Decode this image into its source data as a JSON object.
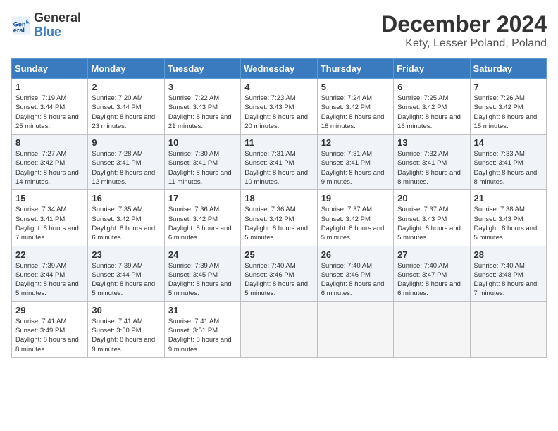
{
  "logo": {
    "line1": "General",
    "line2": "Blue"
  },
  "title": "December 2024",
  "subtitle": "Kety, Lesser Poland, Poland",
  "weekdays": [
    "Sunday",
    "Monday",
    "Tuesday",
    "Wednesday",
    "Thursday",
    "Friday",
    "Saturday"
  ],
  "weeks": [
    [
      {
        "day": "1",
        "sunrise": "7:19 AM",
        "sunset": "3:44 PM",
        "daylight": "8 hours and 25 minutes."
      },
      {
        "day": "2",
        "sunrise": "7:20 AM",
        "sunset": "3:44 PM",
        "daylight": "8 hours and 23 minutes."
      },
      {
        "day": "3",
        "sunrise": "7:22 AM",
        "sunset": "3:43 PM",
        "daylight": "8 hours and 21 minutes."
      },
      {
        "day": "4",
        "sunrise": "7:23 AM",
        "sunset": "3:43 PM",
        "daylight": "8 hours and 20 minutes."
      },
      {
        "day": "5",
        "sunrise": "7:24 AM",
        "sunset": "3:42 PM",
        "daylight": "8 hours and 18 minutes."
      },
      {
        "day": "6",
        "sunrise": "7:25 AM",
        "sunset": "3:42 PM",
        "daylight": "8 hours and 16 minutes."
      },
      {
        "day": "7",
        "sunrise": "7:26 AM",
        "sunset": "3:42 PM",
        "daylight": "8 hours and 15 minutes."
      }
    ],
    [
      {
        "day": "8",
        "sunrise": "7:27 AM",
        "sunset": "3:42 PM",
        "daylight": "8 hours and 14 minutes."
      },
      {
        "day": "9",
        "sunrise": "7:28 AM",
        "sunset": "3:41 PM",
        "daylight": "8 hours and 12 minutes."
      },
      {
        "day": "10",
        "sunrise": "7:30 AM",
        "sunset": "3:41 PM",
        "daylight": "8 hours and 11 minutes."
      },
      {
        "day": "11",
        "sunrise": "7:31 AM",
        "sunset": "3:41 PM",
        "daylight": "8 hours and 10 minutes."
      },
      {
        "day": "12",
        "sunrise": "7:31 AM",
        "sunset": "3:41 PM",
        "daylight": "8 hours and 9 minutes."
      },
      {
        "day": "13",
        "sunrise": "7:32 AM",
        "sunset": "3:41 PM",
        "daylight": "8 hours and 8 minutes."
      },
      {
        "day": "14",
        "sunrise": "7:33 AM",
        "sunset": "3:41 PM",
        "daylight": "8 hours and 8 minutes."
      }
    ],
    [
      {
        "day": "15",
        "sunrise": "7:34 AM",
        "sunset": "3:41 PM",
        "daylight": "8 hours and 7 minutes."
      },
      {
        "day": "16",
        "sunrise": "7:35 AM",
        "sunset": "3:42 PM",
        "daylight": "8 hours and 6 minutes."
      },
      {
        "day": "17",
        "sunrise": "7:36 AM",
        "sunset": "3:42 PM",
        "daylight": "8 hours and 6 minutes."
      },
      {
        "day": "18",
        "sunrise": "7:36 AM",
        "sunset": "3:42 PM",
        "daylight": "8 hours and 5 minutes."
      },
      {
        "day": "19",
        "sunrise": "7:37 AM",
        "sunset": "3:42 PM",
        "daylight": "8 hours and 5 minutes."
      },
      {
        "day": "20",
        "sunrise": "7:37 AM",
        "sunset": "3:43 PM",
        "daylight": "8 hours and 5 minutes."
      },
      {
        "day": "21",
        "sunrise": "7:38 AM",
        "sunset": "3:43 PM",
        "daylight": "8 hours and 5 minutes."
      }
    ],
    [
      {
        "day": "22",
        "sunrise": "7:39 AM",
        "sunset": "3:44 PM",
        "daylight": "8 hours and 5 minutes."
      },
      {
        "day": "23",
        "sunrise": "7:39 AM",
        "sunset": "3:44 PM",
        "daylight": "8 hours and 5 minutes."
      },
      {
        "day": "24",
        "sunrise": "7:39 AM",
        "sunset": "3:45 PM",
        "daylight": "8 hours and 5 minutes."
      },
      {
        "day": "25",
        "sunrise": "7:40 AM",
        "sunset": "3:46 PM",
        "daylight": "8 hours and 5 minutes."
      },
      {
        "day": "26",
        "sunrise": "7:40 AM",
        "sunset": "3:46 PM",
        "daylight": "8 hours and 6 minutes."
      },
      {
        "day": "27",
        "sunrise": "7:40 AM",
        "sunset": "3:47 PM",
        "daylight": "8 hours and 6 minutes."
      },
      {
        "day": "28",
        "sunrise": "7:40 AM",
        "sunset": "3:48 PM",
        "daylight": "8 hours and 7 minutes."
      }
    ],
    [
      {
        "day": "29",
        "sunrise": "7:41 AM",
        "sunset": "3:49 PM",
        "daylight": "8 hours and 8 minutes."
      },
      {
        "day": "30",
        "sunrise": "7:41 AM",
        "sunset": "3:50 PM",
        "daylight": "8 hours and 9 minutes."
      },
      {
        "day": "31",
        "sunrise": "7:41 AM",
        "sunset": "3:51 PM",
        "daylight": "8 hours and 9 minutes."
      },
      null,
      null,
      null,
      null
    ]
  ]
}
